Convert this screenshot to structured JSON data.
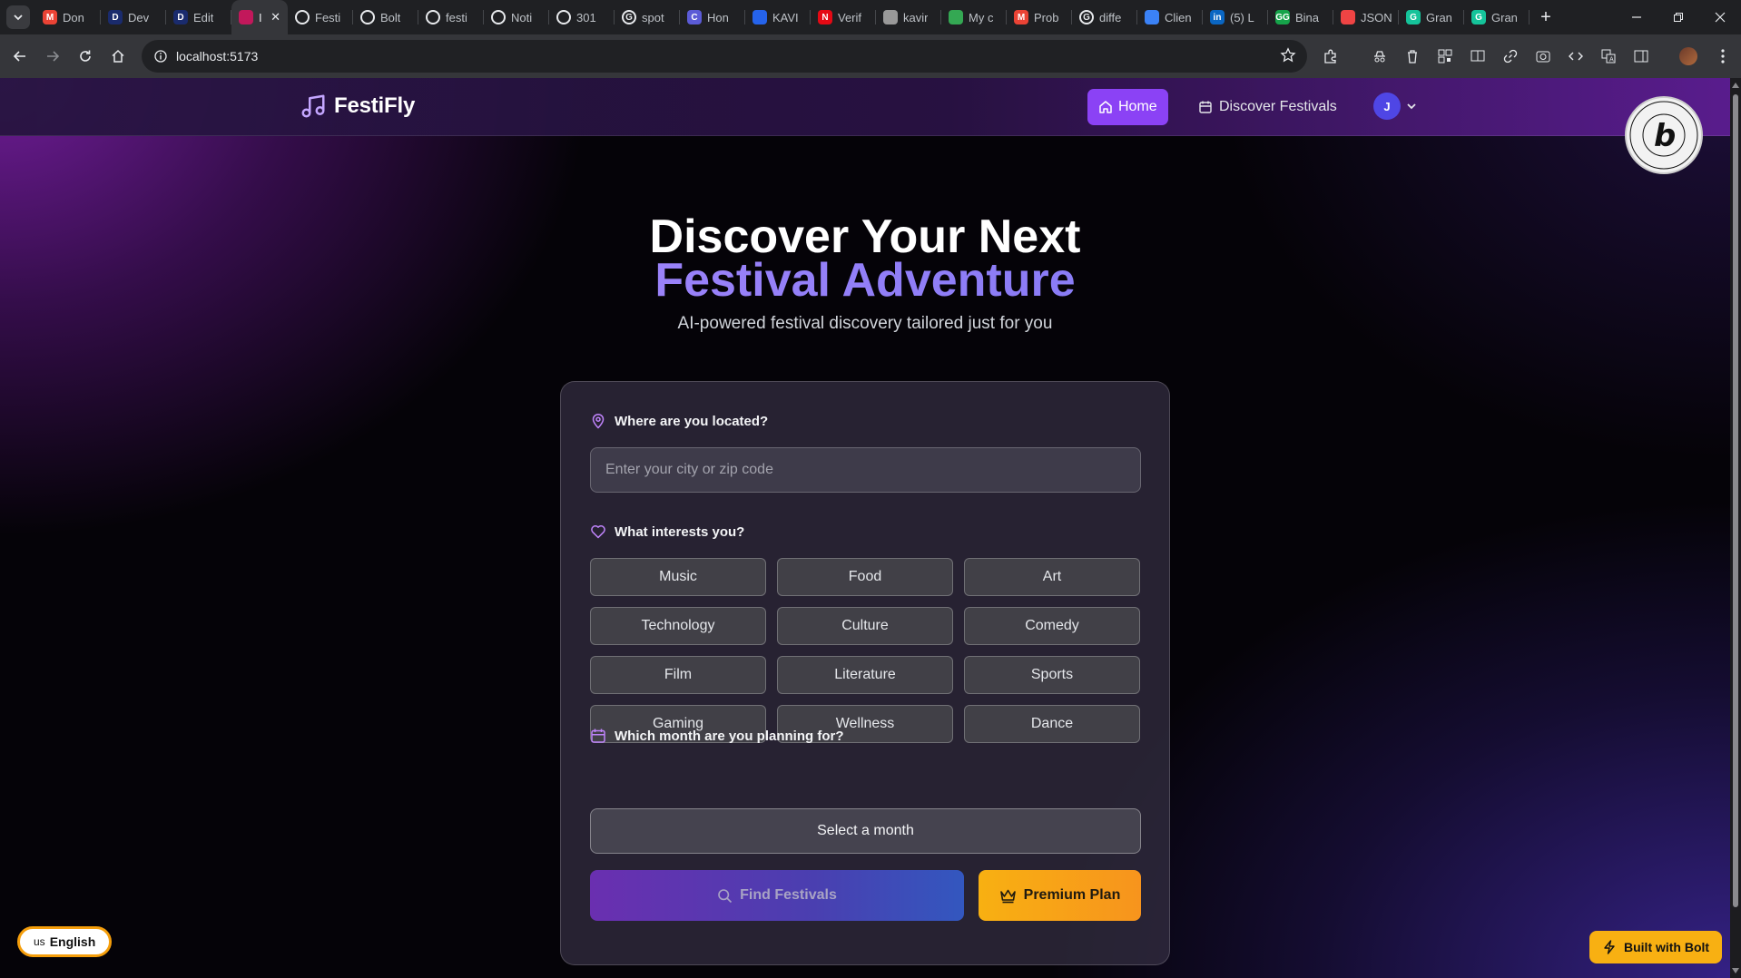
{
  "browser": {
    "tabs": [
      {
        "title": "Don",
        "icon": "gmail-icon",
        "color": "#ea4335",
        "glyph": "M"
      },
      {
        "title": "Dev",
        "icon": "d-icon",
        "color": "#1a2b6d",
        "glyph": "D"
      },
      {
        "title": "Edit",
        "icon": "d-icon",
        "color": "#1a2b6d",
        "glyph": "D"
      },
      {
        "title": "I",
        "icon": "app-icon",
        "color": "#c2185b",
        "glyph": "",
        "active": true
      },
      {
        "title": "Festi",
        "icon": "github-icon",
        "color": "#ffffff",
        "glyph": ""
      },
      {
        "title": "Bolt",
        "icon": "github-icon",
        "color": "#ffffff",
        "glyph": ""
      },
      {
        "title": "festi",
        "icon": "github-icon",
        "color": "#ffffff",
        "glyph": ""
      },
      {
        "title": "Noti",
        "icon": "github-icon",
        "color": "#ffffff",
        "glyph": ""
      },
      {
        "title": "301",
        "icon": "openai-icon",
        "color": "#ffffff",
        "glyph": ""
      },
      {
        "title": "spot",
        "icon": "google-icon",
        "color": "#ffffff",
        "glyph": "G"
      },
      {
        "title": "Hon",
        "icon": "c-icon",
        "color": "#5b5bd6",
        "glyph": "C"
      },
      {
        "title": "KAVI",
        "icon": "kavi-icon",
        "color": "#2563eb",
        "glyph": ""
      },
      {
        "title": "Verif",
        "icon": "n-icon",
        "color": "#e50914",
        "glyph": "N"
      },
      {
        "title": "kavir",
        "icon": "arrow-icon",
        "color": "#999999",
        "glyph": ""
      },
      {
        "title": "My c",
        "icon": "drive-icon",
        "color": "#34a853",
        "glyph": ""
      },
      {
        "title": "Prob",
        "icon": "gmail-icon",
        "color": "#ea4335",
        "glyph": "M"
      },
      {
        "title": "diffe",
        "icon": "google-icon",
        "color": "#ffffff",
        "glyph": "G"
      },
      {
        "title": "Clien",
        "icon": "shield-icon",
        "color": "#3b82f6",
        "glyph": ""
      },
      {
        "title": "(5) L",
        "icon": "linkedin-icon",
        "color": "#0a66c2",
        "glyph": "in"
      },
      {
        "title": "Bina",
        "icon": "gg-icon",
        "color": "#16a34a",
        "glyph": "GG"
      },
      {
        "title": "JSON",
        "icon": "json-icon",
        "color": "#ef4444",
        "glyph": ""
      },
      {
        "title": "Gran",
        "icon": "grammarly-icon",
        "color": "#15c39a",
        "glyph": "G"
      },
      {
        "title": "Gran",
        "icon": "grammarly-icon",
        "color": "#15c39a",
        "glyph": "G"
      }
    ],
    "url": "localhost:5173"
  },
  "header": {
    "brand": "FestiFly",
    "nav_home": "Home",
    "nav_discover": "Discover Festivals",
    "avatar_initial": "J"
  },
  "hero": {
    "title_line1": "Discover Your Next",
    "title_line2": "Festival Adventure",
    "subtitle": "AI-powered festival discovery tailored just for you"
  },
  "form": {
    "location_label": "Where are you located?",
    "location_placeholder": "Enter your city or zip code",
    "location_value": "",
    "interests_label": "What interests you?",
    "interests": [
      "Music",
      "Food",
      "Art",
      "Technology",
      "Culture",
      "Comedy",
      "Film",
      "Literature",
      "Sports",
      "Gaming",
      "Wellness",
      "Dance"
    ],
    "month_label": "Which month are you planning for?",
    "month_placeholder": "Select a month",
    "find_button": "Find Festivals",
    "premium_button": "Premium Plan"
  },
  "footer": {
    "language_flag": "us",
    "language": "English",
    "built_with": "Built with Bolt"
  },
  "colors": {
    "accent": "#8b42f5",
    "premium": "#f8b012",
    "avatar": "#4f46e5"
  }
}
